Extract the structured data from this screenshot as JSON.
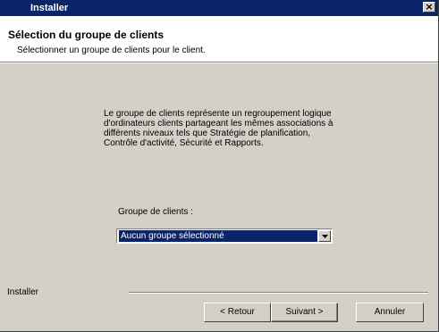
{
  "window": {
    "title": "Installer",
    "close_glyph": "×"
  },
  "header": {
    "title": "Sélection du groupe de clients",
    "subtitle": "Sélectionner un groupe de clients pour le client."
  },
  "body": {
    "description": "Le groupe de clients représente un regroupement logique d'ordinateurs clients partageant les mêmes associations à différents niveaux tels que Stratégie de planification, Contrôle d'activité, Sécurité et Rapports.",
    "group_label": "Groupe de clients :",
    "group_value": "Aucun groupe sélectionné"
  },
  "footer": {
    "label": "Installer",
    "back": "< Retour",
    "next": "Suivant >",
    "cancel": "Annuler"
  }
}
